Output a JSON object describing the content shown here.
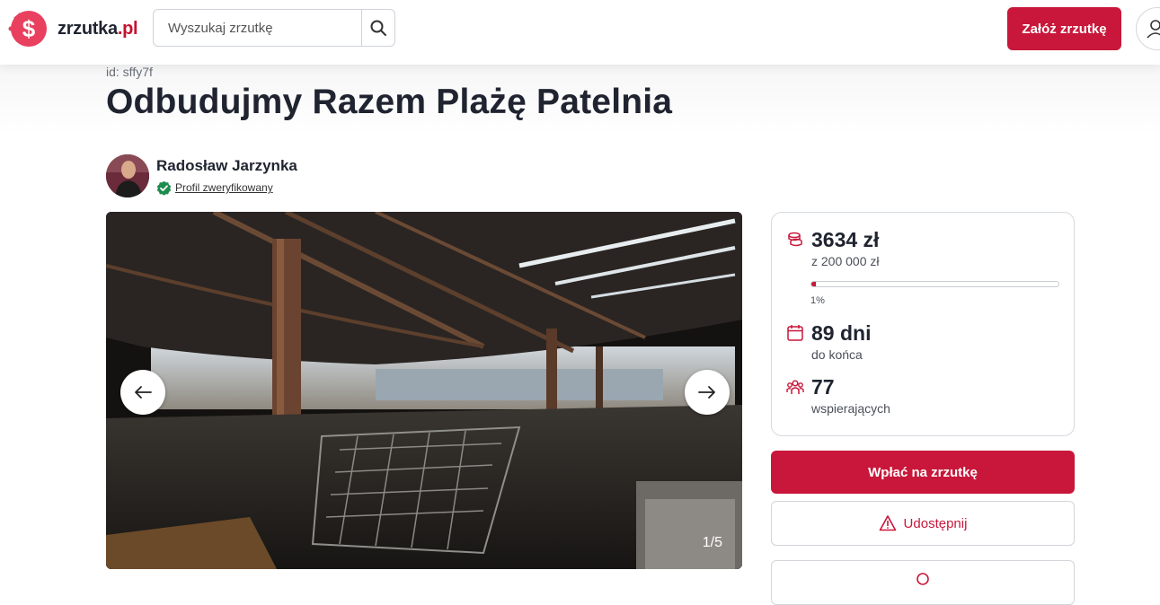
{
  "header": {
    "logo_name": "zrzutka",
    "logo_tld": ".pl",
    "search_placeholder": "Wyszukaj zrzutkę",
    "create_button": "Załóż zrzutkę",
    "accent_color": "#c8173a"
  },
  "fundraiser": {
    "id_text": "id: sffy7f",
    "title": "Odbudujmy Razem Plażę Patelnia",
    "author_name": "Radosław Jarzynka",
    "verified_label": "Profil zweryfikowany"
  },
  "gallery": {
    "counter": "1/5",
    "prev_icon": "arrow-left-icon",
    "next_icon": "arrow-right-icon"
  },
  "stats": {
    "raised": "3634 zł",
    "goal": "z 200 000 zł",
    "progress_percent": "1%",
    "progress_fraction": 0.018,
    "days": "89 dni",
    "days_label": "do końca",
    "supporters": "77",
    "supporters_label": "wspierających"
  },
  "actions": {
    "donate": "Wpłać na zrzutkę",
    "share": "Udostępnij"
  }
}
